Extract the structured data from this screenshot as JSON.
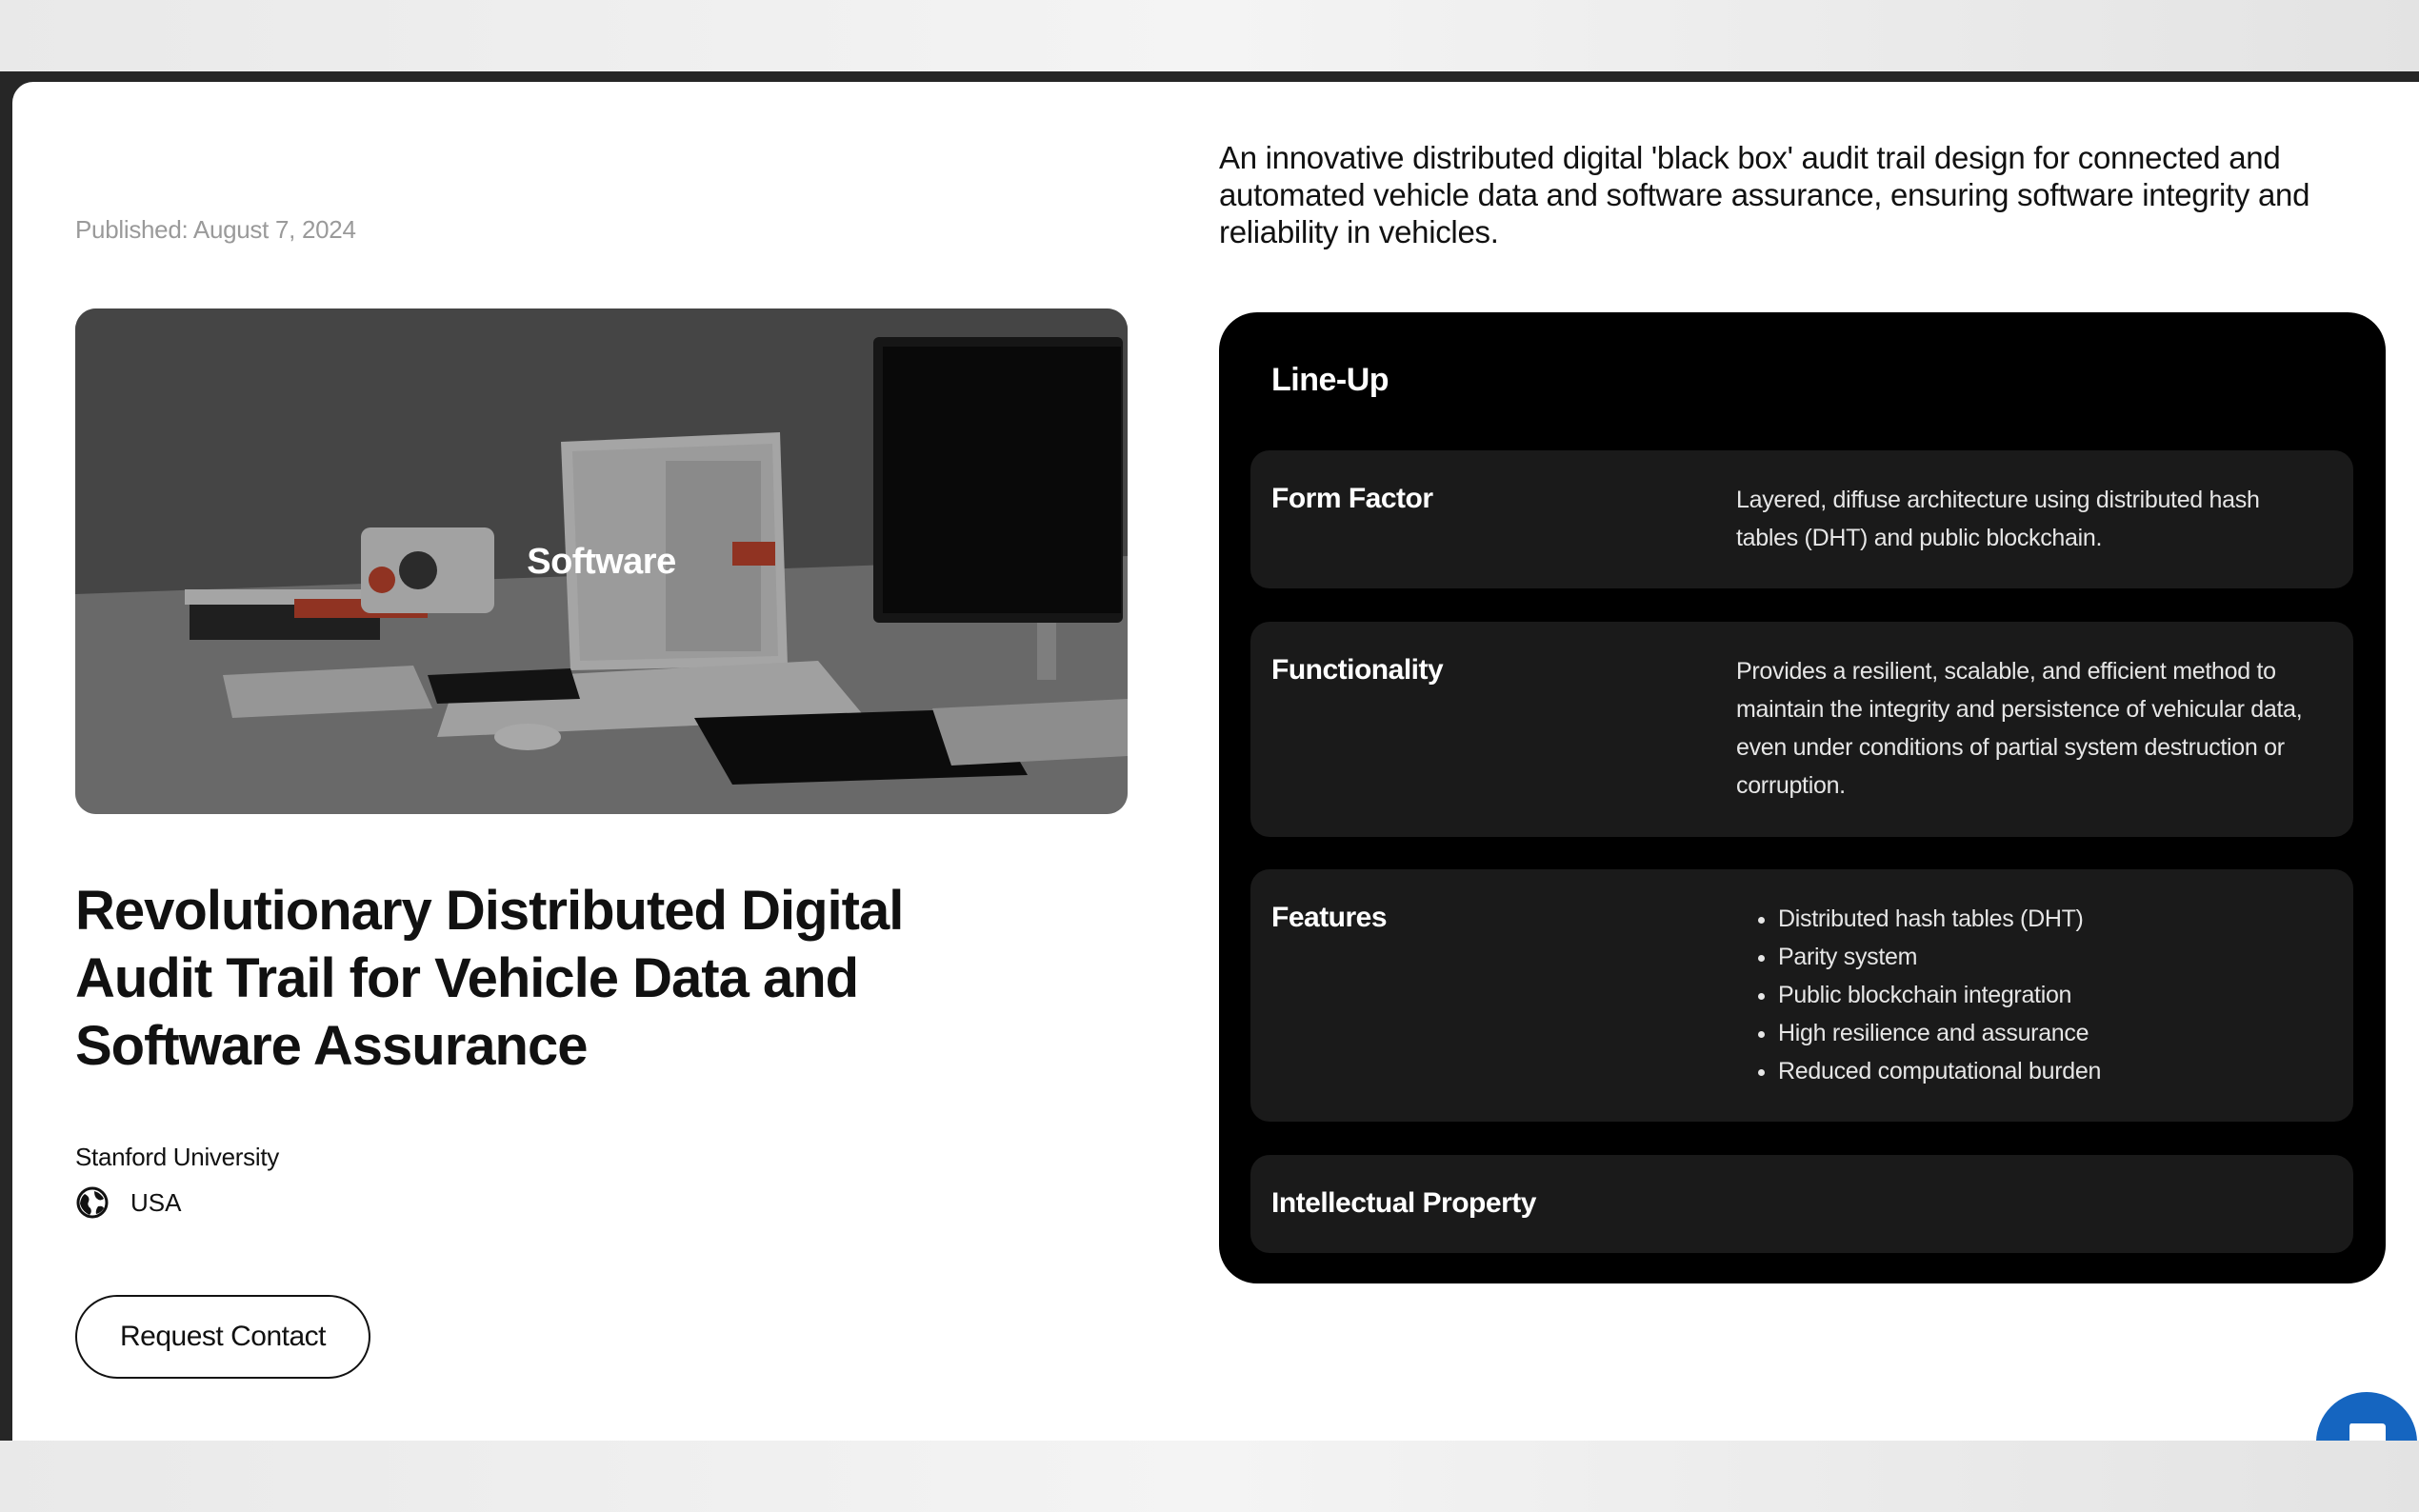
{
  "published": "Published: August 7, 2024",
  "hero": {
    "category_label": "Software"
  },
  "title": "Revolutionary Distributed Digital Audit Trail for Vehicle Data and Software Assurance",
  "organization": "Stanford University",
  "country": "USA",
  "cta_label": "Request Contact",
  "summary": "An innovative distributed digital 'black box' audit trail design for connected and automated vehicle data and software assurance, ensuring software integrity and reliability in vehicles.",
  "lineup": {
    "title": "Line-Up",
    "form_factor": {
      "name": "Form Factor",
      "description": "Layered, diffuse architecture using distributed hash tables (DHT) and public blockchain."
    },
    "functionality": {
      "name": "Functionality",
      "description": "Provides a resilient, scalable, and efficient method to maintain the integrity and persistence of vehicular data, even under conditions of partial system destruction or corruption."
    },
    "features": {
      "name": "Features",
      "items": [
        "Distributed hash tables (DHT)",
        "Parity system",
        "Public blockchain integration",
        "High resilience and assurance",
        "Reduced computational burden"
      ]
    },
    "intellectual_property": {
      "name": "Intellectual Property"
    }
  },
  "colors": {
    "chat_button": "#1565c0",
    "card_background": "#000000",
    "spec_row": "#1a1a1a"
  },
  "icons": {
    "country": "globe-icon",
    "chat": "chat-icon"
  }
}
